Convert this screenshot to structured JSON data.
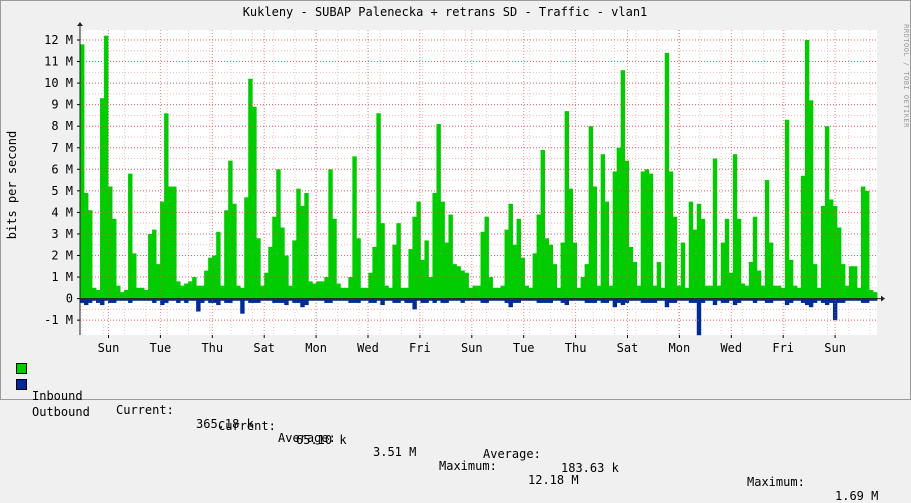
{
  "chart_data": {
    "type": "area",
    "title": "Kukleny - SUBAP Palenecka + retrans SD - Traffic - vlan1",
    "ylabel": "bits per second",
    "ylim": [
      -1.1,
      12.5
    ],
    "y_ticks": [
      "-1 M",
      "0",
      "1 M",
      "2 M",
      "3 M",
      "4 M",
      "5 M",
      "6 M",
      "7 M",
      "8 M",
      "9 M",
      "10 M",
      "11 M",
      "12 M"
    ],
    "x_ticks": [
      "Sun",
      "Tue",
      "Thu",
      "Sat",
      "Mon",
      "Wed",
      "Fri",
      "Sun",
      "Tue",
      "Thu",
      "Sat",
      "Mon",
      "Wed",
      "Fri",
      "Sun"
    ],
    "grid": true,
    "series": [
      {
        "name": "Inbound",
        "color": "#00cc00",
        "values": [
          11.8,
          4.9,
          4.1,
          0.5,
          0.4,
          9.3,
          12.2,
          5.2,
          3.7,
          0.6,
          0.3,
          0.4,
          5.8,
          2.1,
          0.5,
          0.5,
          0.4,
          3.0,
          3.2,
          1.6,
          4.5,
          8.6,
          5.2,
          5.2,
          0.8,
          0.6,
          0.7,
          0.8,
          1.0,
          0.6,
          0.6,
          1.3,
          1.9,
          2.0,
          3.1,
          0.6,
          4.1,
          6.4,
          4.4,
          0.6,
          0.5,
          4.7,
          10.2,
          8.9,
          2.8,
          0.6,
          1.2,
          2.4,
          3.8,
          6.0,
          3.3,
          2.0,
          0.6,
          2.7,
          5.1,
          4.3,
          4.9,
          0.8,
          0.7,
          0.8,
          0.8,
          1.0,
          6.0,
          3.7,
          0.7,
          0.5,
          0.5,
          1.0,
          6.6,
          2.8,
          0.5,
          0.5,
          1.2,
          2.4,
          8.6,
          3.5,
          0.6,
          0.5,
          2.5,
          3.5,
          0.5,
          0.5,
          2.3,
          3.8,
          4.5,
          1.8,
          2.7,
          1.0,
          4.9,
          8.1,
          4.5,
          2.6,
          3.9,
          1.6,
          1.5,
          1.3,
          1.2,
          0.5,
          0.6,
          0.6,
          3.1,
          3.8,
          1.0,
          0.5,
          0.5,
          0.6,
          3.2,
          4.4,
          2.5,
          3.7,
          1.9,
          0.6,
          0.5,
          2.1,
          3.9,
          6.9,
          2.8,
          2.5,
          1.6,
          0.5,
          2.6,
          8.7,
          5.1,
          2.6,
          0.5,
          1.0,
          1.6,
          8.0,
          5.2,
          0.6,
          6.7,
          4.5,
          0.6,
          5.9,
          7.0,
          10.6,
          6.4,
          2.4,
          1.7,
          0.6,
          5.9,
          6.0,
          5.8,
          0.6,
          1.7,
          0.5,
          11.4,
          5.9,
          3.8,
          0.6,
          2.6,
          0.5,
          4.5,
          3.2,
          4.4,
          3.7,
          0.6,
          0.6,
          6.5,
          0.6,
          2.6,
          3.7,
          1.2,
          6.7,
          3.7,
          0.7,
          0.6,
          1.7,
          3.8,
          1.3,
          0.6,
          5.5,
          2.6,
          0.6,
          0.6,
          0.5,
          8.3,
          1.8,
          0.6,
          0.5,
          5.7,
          12.0,
          9.2,
          1.6,
          0.5,
          4.3,
          8.0,
          4.6,
          4.3,
          3.3,
          1.6,
          0.6,
          1.5,
          1.5,
          0.5,
          5.2,
          5.0,
          0.4,
          0.3
        ]
      },
      {
        "name": "Outbound",
        "color": "#002a97",
        "values": [
          -0.2,
          -0.3,
          -0.2,
          -0.1,
          -0.2,
          -0.3,
          -0.1,
          -0.2,
          -0.2,
          -0.1,
          -0.1,
          -0.1,
          -0.2,
          -0.1,
          -0.1,
          -0.1,
          -0.1,
          -0.1,
          -0.2,
          -0.1,
          -0.3,
          -0.2,
          -0.1,
          -0.1,
          -0.2,
          -0.1,
          -0.2,
          -0.1,
          -0.1,
          -0.6,
          -0.2,
          -0.1,
          -0.2,
          -0.2,
          -0.3,
          -0.1,
          -0.2,
          -0.2,
          -0.1,
          -0.1,
          -0.7,
          -0.1,
          -0.2,
          -0.2,
          -0.2,
          -0.1,
          -0.1,
          -0.1,
          -0.2,
          -0.2,
          -0.2,
          -0.3,
          -0.1,
          -0.2,
          -0.2,
          -0.4,
          -0.3,
          -0.1,
          -0.1,
          -0.1,
          -0.1,
          -0.2,
          -0.2,
          -0.1,
          -0.1,
          -0.1,
          -0.1,
          -0.2,
          -0.2,
          -0.2,
          -0.1,
          -0.1,
          -0.2,
          -0.2,
          -0.1,
          -0.3,
          -0.1,
          -0.1,
          -0.2,
          -0.2,
          -0.1,
          -0.2,
          -0.2,
          -0.5,
          -0.1,
          -0.2,
          -0.2,
          -0.1,
          -0.2,
          -0.1,
          -0.2,
          -0.2,
          -0.1,
          -0.1,
          -0.1,
          -0.2,
          -0.1,
          -0.1,
          -0.1,
          -0.1,
          -0.2,
          -0.2,
          -0.1,
          -0.1,
          -0.1,
          -0.1,
          -0.2,
          -0.4,
          -0.2,
          -0.2,
          -0.1,
          -0.1,
          -0.1,
          -0.1,
          -0.2,
          -0.2,
          -0.2,
          -0.2,
          -0.1,
          -0.1,
          -0.2,
          -0.3,
          -0.1,
          -0.1,
          -0.1,
          -0.1,
          -0.2,
          -0.2,
          -0.2,
          -0.1,
          -0.2,
          -0.2,
          -0.1,
          -0.4,
          -0.2,
          -0.3,
          -0.2,
          -0.1,
          -0.1,
          -0.1,
          -0.2,
          -0.2,
          -0.2,
          -0.2,
          -0.1,
          -0.1,
          -0.4,
          -0.2,
          -0.2,
          -0.1,
          -0.1,
          -0.1,
          -0.2,
          -0.2,
          -1.7,
          -0.2,
          -0.1,
          -0.1,
          -0.3,
          -0.1,
          -0.2,
          -0.2,
          -0.1,
          -0.3,
          -0.2,
          -0.1,
          -0.1,
          -0.1,
          -0.2,
          -0.1,
          -0.1,
          -0.2,
          -0.2,
          -0.1,
          -0.1,
          -0.1,
          -0.3,
          -0.2,
          -0.1,
          -0.1,
          -0.2,
          -0.3,
          -0.4,
          -0.2,
          -0.1,
          -0.2,
          -0.3,
          -0.2,
          -1.0,
          -0.2,
          -0.2,
          -0.1,
          -0.1,
          -0.1,
          -0.1,
          -0.2,
          -0.2,
          -0.1,
          -0.1
        ]
      }
    ]
  },
  "legend": {
    "inbound": {
      "label": "Inbound",
      "current_label": "Current:",
      "current": "365.18 k",
      "average_label": "Average:",
      "average": "3.51 M",
      "maximum_label": "Maximum:",
      "maximum": "12.18 M"
    },
    "outbound": {
      "label": "Outbound",
      "current_label": "Current:",
      "current": "65.10 k",
      "average_label": "Average:",
      "average": "183.63 k",
      "maximum_label": "Maximum:",
      "maximum": "1.69 M"
    }
  },
  "watermark": "RRDTOOL / TOBI OETIKER"
}
